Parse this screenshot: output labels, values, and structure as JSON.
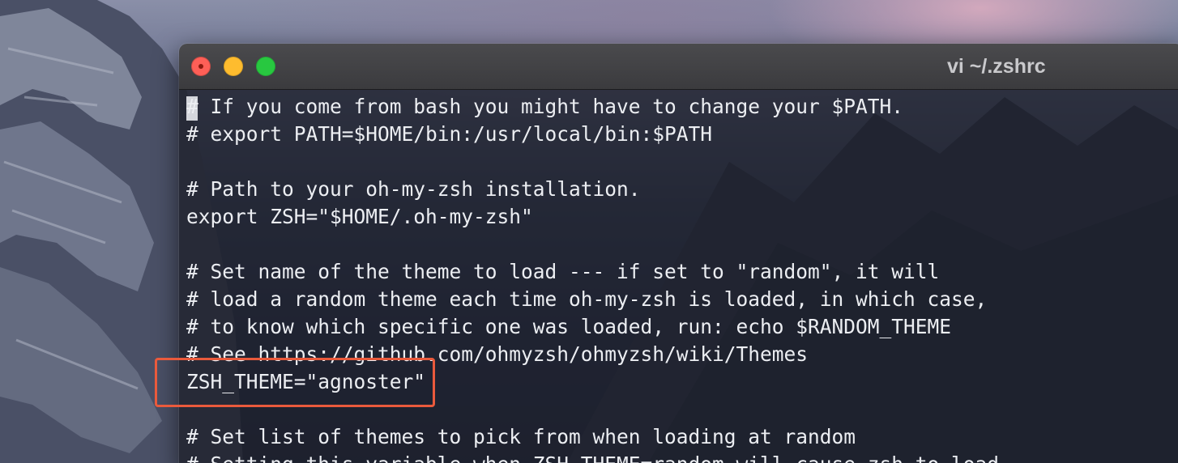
{
  "window": {
    "title": "vi ~/.zshrc",
    "traffic_lights": {
      "close": "#fe5f57",
      "minimize": "#febc2e",
      "zoom": "#28c840"
    }
  },
  "editor": {
    "lines": [
      "# If you come from bash you might have to change your $PATH.",
      "# export PATH=$HOME/bin:/usr/local/bin:$PATH",
      "",
      "# Path to your oh-my-zsh installation.",
      "export ZSH=\"$HOME/.oh-my-zsh\"",
      "",
      "# Set name of the theme to load --- if set to \"random\", it will",
      "# load a random theme each time oh-my-zsh is loaded, in which case,",
      "# to know which specific one was loaded, run: echo $RANDOM_THEME",
      "# See https://github.com/ohmyzsh/ohmyzsh/wiki/Themes",
      "ZSH_THEME=\"agnoster\"",
      "",
      "# Set list of themes to pick from when loading at random",
      "# Setting this variable when ZSH_THEME=random will cause zsh to load"
    ],
    "highlighted_line": "ZSH_THEME=\"agnoster\"",
    "highlight_color": "#ea5a3c"
  }
}
